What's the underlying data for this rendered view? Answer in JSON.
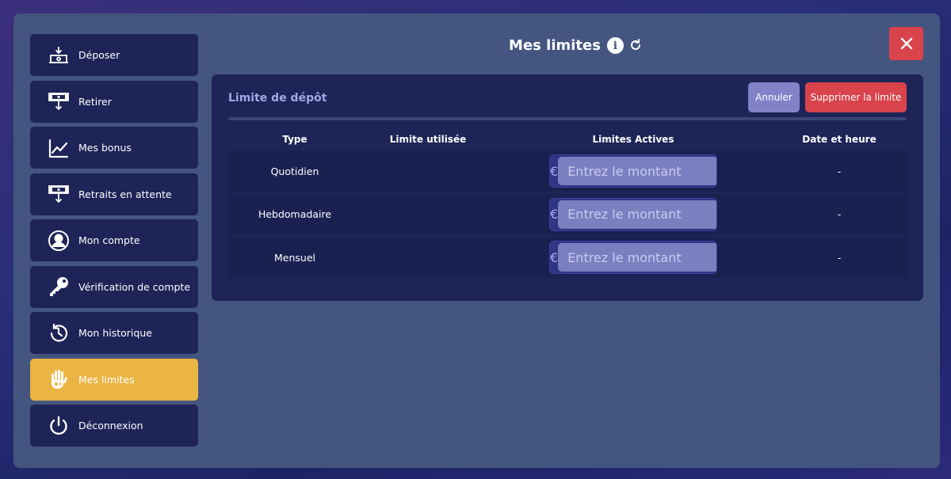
{
  "header": {
    "title": "Mes limites",
    "info_glyph": "i"
  },
  "sidebar": {
    "items": [
      {
        "label": "Déposer",
        "icon": "deposit-icon"
      },
      {
        "label": "Retirer",
        "icon": "withdraw-icon"
      },
      {
        "label": "Mes bonus",
        "icon": "chart-icon"
      },
      {
        "label": "Retraits en attente",
        "icon": "pending-withdraw-icon"
      },
      {
        "label": "Mon compte",
        "icon": "user-icon"
      },
      {
        "label": "Vérification de compte",
        "icon": "key-icon"
      },
      {
        "label": "Mon historique",
        "icon": "history-icon"
      },
      {
        "label": "Mes limites",
        "icon": "hand-icon",
        "active": true
      },
      {
        "label": "Déconnexion",
        "icon": "power-icon"
      }
    ]
  },
  "panel": {
    "title": "Limite de dépôt",
    "cancel_label": "Annuler",
    "delete_label": "Supprimer la limite",
    "columns": [
      "Type",
      "Limite utilisée",
      "Limites Actives",
      "Date et heure"
    ],
    "rows": [
      {
        "type": "Quotidien",
        "used": "",
        "currency": "€",
        "placeholder": "Entrez le montant",
        "date": "-"
      },
      {
        "type": "Hebdomadaire",
        "used": "",
        "currency": "€",
        "placeholder": "Entrez le montant",
        "date": "-"
      },
      {
        "type": "Mensuel",
        "used": "",
        "currency": "€",
        "placeholder": "Entrez le montant",
        "date": "-"
      }
    ]
  },
  "colors": {
    "active": "#ebb544",
    "danger": "#d9434c",
    "panel": "#1e2457",
    "modal": "#445580"
  }
}
